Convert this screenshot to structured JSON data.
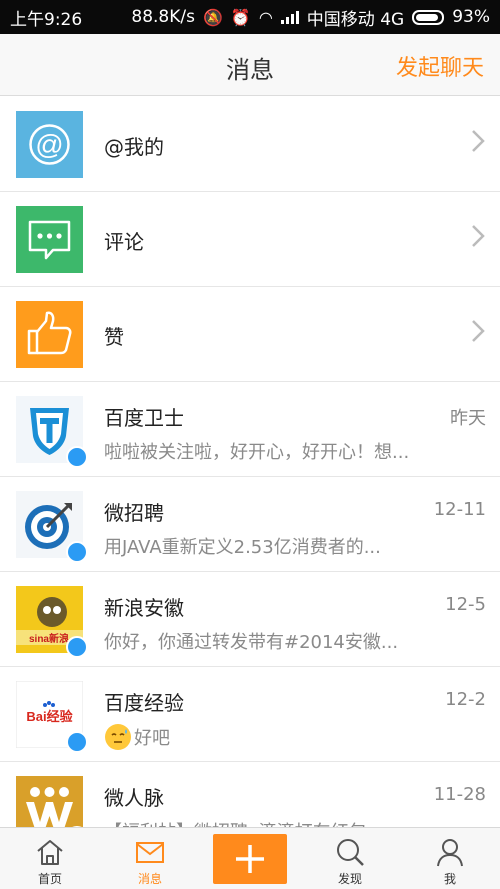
{
  "status_bar": {
    "time": "上午9:26",
    "speed": "88.8K/s",
    "carrier": "中国移动 4G",
    "battery": "93%"
  },
  "header": {
    "title": "消息",
    "action": "发起聊天"
  },
  "rows": [
    {
      "name": "@我的"
    },
    {
      "name": "评论"
    },
    {
      "name": "赞"
    },
    {
      "name": "百度卫士",
      "time": "昨天",
      "preview": "啦啦被关注啦，好开心，好开心！想..."
    },
    {
      "name": "微招聘",
      "time": "12-11",
      "preview": "用JAVA重新定义2.53亿消费者的..."
    },
    {
      "name": "新浪安徽",
      "time": "12-5",
      "preview": "你好，你通过转发带有#2014安徽..."
    },
    {
      "name": "百度经验",
      "time": "12-2",
      "preview": "好吧"
    },
    {
      "name": "微人脉",
      "time": "11-28",
      "preview": "【福利帖】微招聘x滴滴打车红包..."
    }
  ],
  "avatar_text": {
    "mention": "@",
    "sina": "sina新浪",
    "baidu": "Bai经验"
  },
  "tabs": [
    {
      "label": "首页"
    },
    {
      "label": "消息"
    },
    {
      "label": ""
    },
    {
      "label": "发现"
    },
    {
      "label": "我"
    }
  ],
  "colors": {
    "accent": "#ff8a1c",
    "mention_tile": "#5ab4e0",
    "comment_tile": "#3db86b",
    "like_tile": "#ff9c1c",
    "verified": "#2b9bf4"
  }
}
